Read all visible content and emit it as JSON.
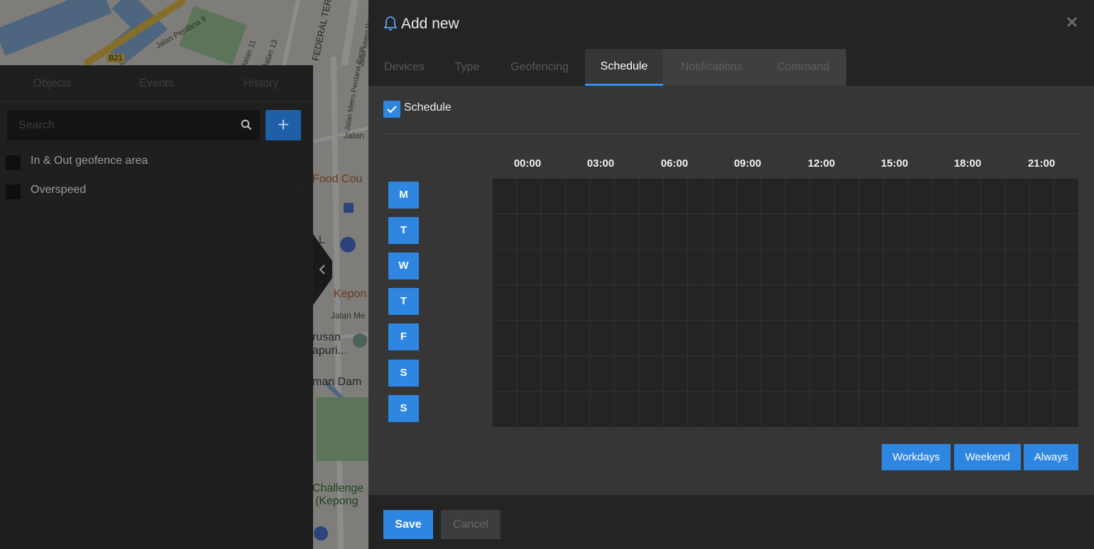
{
  "map": {
    "labels": [
      "B21",
      "Jalan Perdana 9",
      "Jalan 11",
      "Jalan 13",
      "FEDERAL TERR",
      "Jalan Metro Perdana Barat",
      "Jalan Metro Perdana Barat",
      "Jalan",
      "Food Cou",
      "LL",
      "Kepon",
      "Jalan Me",
      "rusan",
      "apuri...",
      "man Dam",
      "Challenge",
      "(Kepong"
    ]
  },
  "sidebar": {
    "tabs": [
      "Objects",
      "Events",
      "History"
    ],
    "search": {
      "placeholder": "Search",
      "value": ""
    },
    "add_label": "+",
    "items": [
      {
        "label": "In & Out geofence area",
        "checked": false
      },
      {
        "label": "Overspeed",
        "checked": false
      }
    ]
  },
  "modal": {
    "title": "Add new",
    "close_label": "×",
    "icons": {
      "title": "bell-icon",
      "close": "close-icon"
    },
    "tabs": [
      "Devices",
      "Type",
      "Geofencing",
      "Schedule",
      "Notifications",
      "Command"
    ],
    "active_tab": "Schedule",
    "schedule": {
      "checkbox_label": "Schedule",
      "enabled": true,
      "hours": [
        "00:00",
        "03:00",
        "06:00",
        "09:00",
        "12:00",
        "15:00",
        "18:00",
        "21:00"
      ],
      "days": [
        "M",
        "T",
        "W",
        "T",
        "F",
        "S",
        "S"
      ],
      "presets": [
        "Workdays",
        "Weekend",
        "Always"
      ]
    },
    "footer": {
      "save": "Save",
      "cancel": "Cancel"
    }
  },
  "colors": {
    "accent": "#2f86e0",
    "modal_bg": "#363636",
    "header_bg": "#242424"
  }
}
